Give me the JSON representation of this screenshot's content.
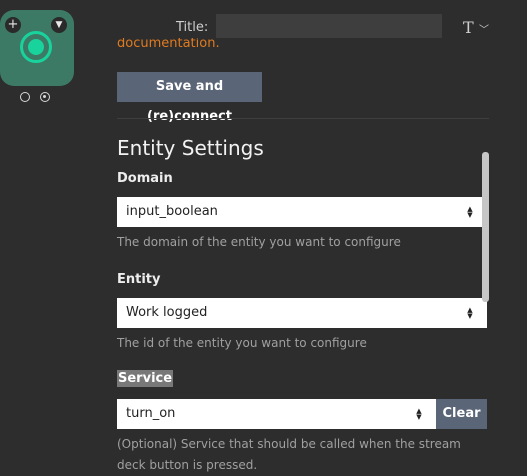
{
  "key": {
    "add_glyph": "+",
    "chevron_glyph": "⌄",
    "accent_color": "#18d39c"
  },
  "title_row": {
    "label": "Title:",
    "value": "",
    "format_glyph": "T",
    "format_chevron": "⌵"
  },
  "docs_link": "documentation.",
  "save_button": "Save and (re)connect",
  "entity_settings": {
    "heading": "Entity Settings",
    "domain": {
      "label": "Domain",
      "selected": "input_boolean",
      "help": "The domain of the entity you want to configure"
    },
    "entity": {
      "label": "Entity",
      "selected": "Work logged",
      "help": "The id of the entity you want to configure"
    },
    "service": {
      "label": "Service",
      "selected": "turn_on",
      "clear": "Clear",
      "help": "(Optional) Service that should be called when the stream deck button is pressed."
    }
  },
  "colors": {
    "background": "#2d2d2d",
    "button": "#5a6577",
    "link": "#e07a1f"
  }
}
